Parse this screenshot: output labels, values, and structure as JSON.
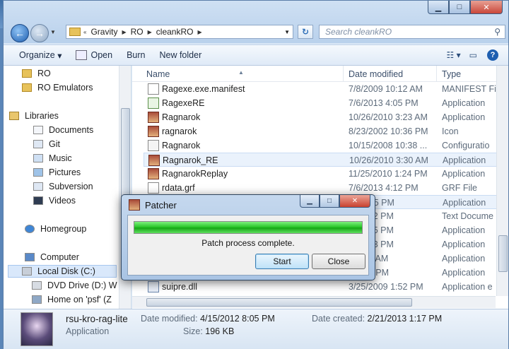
{
  "address": {
    "crumbs": [
      "Gravity",
      "RO",
      "cleankRO"
    ],
    "search_placeholder": "Search cleankRO"
  },
  "toolbar": {
    "organize": "Organize",
    "open": "Open",
    "burn": "Burn",
    "new_folder": "New folder"
  },
  "nav": {
    "items": [
      {
        "label": "RO",
        "icon": "folder-icon"
      },
      {
        "label": "RO Emulators",
        "icon": "folder-icon"
      },
      {
        "label": "Libraries",
        "icon": "libraries-icon"
      },
      {
        "label": "Documents",
        "icon": "documents-icon"
      },
      {
        "label": "Git",
        "icon": "git-icon"
      },
      {
        "label": "Music",
        "icon": "music-icon"
      },
      {
        "label": "Pictures",
        "icon": "pictures-icon"
      },
      {
        "label": "Subversion",
        "icon": "subversion-icon"
      },
      {
        "label": "Videos",
        "icon": "videos-icon"
      },
      {
        "label": "Homegroup",
        "icon": "homegroup-icon"
      },
      {
        "label": "Computer",
        "icon": "computer-icon"
      },
      {
        "label": "Local Disk (C:)",
        "icon": "disk-icon"
      },
      {
        "label": "DVD Drive (D:) W",
        "icon": "dvd-icon"
      },
      {
        "label": "Home on 'psf' (Z",
        "icon": "network-drive-icon"
      }
    ]
  },
  "columns": {
    "name": "Name",
    "date": "Date modified",
    "type": "Type"
  },
  "files": [
    {
      "name": "Ragexe.exe.manifest",
      "date": "7/8/2009 10:12 AM",
      "type": "MANIFEST Fi"
    },
    {
      "name": "RagexeRE",
      "date": "7/6/2013 4:05 PM",
      "type": "Application"
    },
    {
      "name": "Ragnarok",
      "date": "10/26/2010 3:23 AM",
      "type": "Application"
    },
    {
      "name": "ragnarok",
      "date": "8/23/2002 10:36 PM",
      "type": "Icon"
    },
    {
      "name": "Ragnarok",
      "date": "10/15/2008 10:38 ...",
      "type": "Configuratio"
    },
    {
      "name": "Ragnarok_RE",
      "date": "10/26/2010 3:30 AM",
      "type": "Application"
    },
    {
      "name": "RagnarokReplay",
      "date": "11/25/2010 1:24 PM",
      "type": "Application"
    },
    {
      "name": "rdata.grf",
      "date": "7/6/2013 4:12 PM",
      "type": "GRF File"
    },
    {
      "name": "",
      "date": "12 8:05 PM",
      "type": "Application"
    },
    {
      "name": "",
      "date": "13 2:52 PM",
      "type": "Text Docume"
    },
    {
      "name": "",
      "date": "12 8:05 PM",
      "type": "Application"
    },
    {
      "name": "",
      "date": "10 1:13 PM",
      "type": "Application"
    },
    {
      "name": "",
      "date": "0 9:22 AM",
      "type": "Application"
    },
    {
      "name": "",
      "date": "3 3:02 PM",
      "type": "Application"
    },
    {
      "name": "suipre.dll",
      "date": "3/25/2009 1:52 PM",
      "type": "Application e"
    }
  ],
  "details": {
    "name": "rsu-kro-rag-lite",
    "kind": "Application",
    "modified_label": "Date modified:",
    "modified": "4/15/2012 8:05 PM",
    "created_label": "Date created:",
    "created": "2/21/2013 1:17 PM",
    "size_label": "Size:",
    "size": "196 KB"
  },
  "dialog": {
    "title": "Patcher",
    "progress": 1.0,
    "message": "Patch process complete.",
    "start": "Start",
    "close": "Close"
  }
}
